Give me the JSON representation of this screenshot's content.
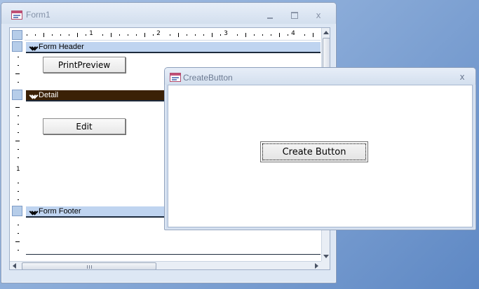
{
  "form1": {
    "title": "Form1",
    "controls": {
      "minimize": "_",
      "maximize": "□",
      "close": "x"
    },
    "ruler": {
      "numbers": [
        "1",
        "2",
        "3",
        "4"
      ]
    },
    "vertical_ruler": {
      "numbers": [
        "1"
      ]
    },
    "sections": {
      "header": {
        "label": "Form Header",
        "button_label": "PrintPreview"
      },
      "detail": {
        "label": "Detail",
        "button_label": "Edit"
      },
      "footer": {
        "label": "Form Footer"
      }
    },
    "selected_section": "detail",
    "colors": {
      "band": "#bfd4f0",
      "band_selected": "#3b2106"
    }
  },
  "create_window": {
    "title": "CreateButton",
    "close": "x",
    "button_label": "Create Button"
  }
}
